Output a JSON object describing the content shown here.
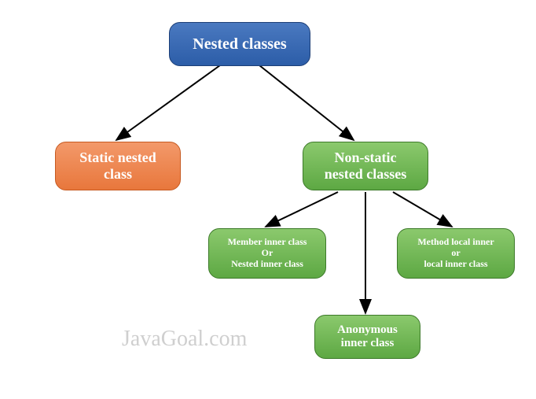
{
  "watermark": "JavaGoal.com",
  "nodes": {
    "root": {
      "label": "Nested classes"
    },
    "static_nested": {
      "line1": "Static nested",
      "line2": "class"
    },
    "non_static": {
      "line1": "Non-static",
      "line2": "nested classes"
    },
    "member_inner": {
      "line1": "Member inner class",
      "line2": "Or",
      "line3": "Nested inner class"
    },
    "method_local": {
      "line1": "Method local inner",
      "line2": "or",
      "line3": "local inner class"
    },
    "anonymous": {
      "line1": "Anonymous",
      "line2": "inner class"
    }
  },
  "colors": {
    "blue": "#2c5da8",
    "orange": "#e8773c",
    "green": "#5da843"
  },
  "chart_data": {
    "type": "tree",
    "title": "Nested classes hierarchy",
    "root": "Nested classes",
    "children": [
      {
        "name": "Static nested class",
        "children": []
      },
      {
        "name": "Non-static nested classes",
        "children": [
          {
            "name": "Member inner class / Nested inner class"
          },
          {
            "name": "Anonymous inner class"
          },
          {
            "name": "Method local inner / local inner class"
          }
        ]
      }
    ]
  }
}
